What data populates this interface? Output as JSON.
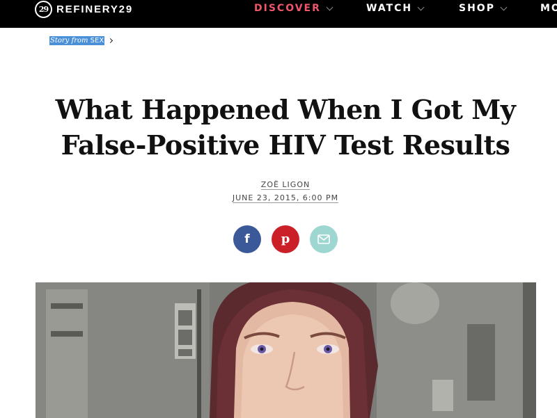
{
  "brand": {
    "name": "REFINERY29",
    "mark": "29"
  },
  "nav": {
    "items": [
      {
        "label": "DISCOVER",
        "active": true
      },
      {
        "label": "WATCH",
        "active": false
      },
      {
        "label": "SHOP",
        "active": false
      },
      {
        "label": "MO",
        "active": false
      }
    ]
  },
  "breadcrumb": {
    "prefix": "Story from ",
    "section": "SEX"
  },
  "article": {
    "title_line1": "What Happened When I Got My",
    "title_line2": "False-Positive HIV Test Results",
    "author": "ZOË LIGON",
    "date": "JUNE 23, 2015, 6:00 PM"
  },
  "share": {
    "facebook": "f",
    "pinterest": "p"
  },
  "icons": {
    "facebook": "facebook-icon",
    "pinterest": "pinterest-icon",
    "email": "email-icon",
    "chevron": "chevron-down-icon"
  },
  "colors": {
    "nav_bg": "#000000",
    "nav_active": "#f0566a",
    "highlight": "#4a90d9",
    "facebook": "#3b5998",
    "pinterest": "#cb2027",
    "email": "#9ed6d2"
  }
}
